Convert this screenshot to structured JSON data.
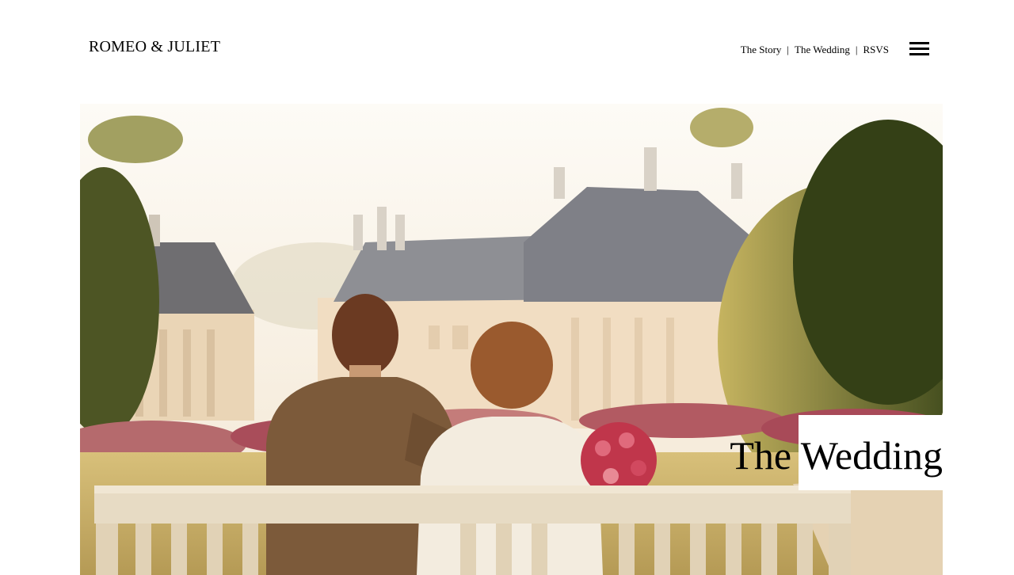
{
  "site": {
    "logo": "ROMEO & JULIET"
  },
  "nav": {
    "items": [
      {
        "label": "The Story"
      },
      {
        "label": "The Wedding"
      },
      {
        "label": "RSVS"
      }
    ],
    "separator": "|",
    "menu_icon": "hamburger-menu-icon"
  },
  "hero": {
    "caption": "The Wedding",
    "image_subject": "couple on bench facing palace garden"
  }
}
